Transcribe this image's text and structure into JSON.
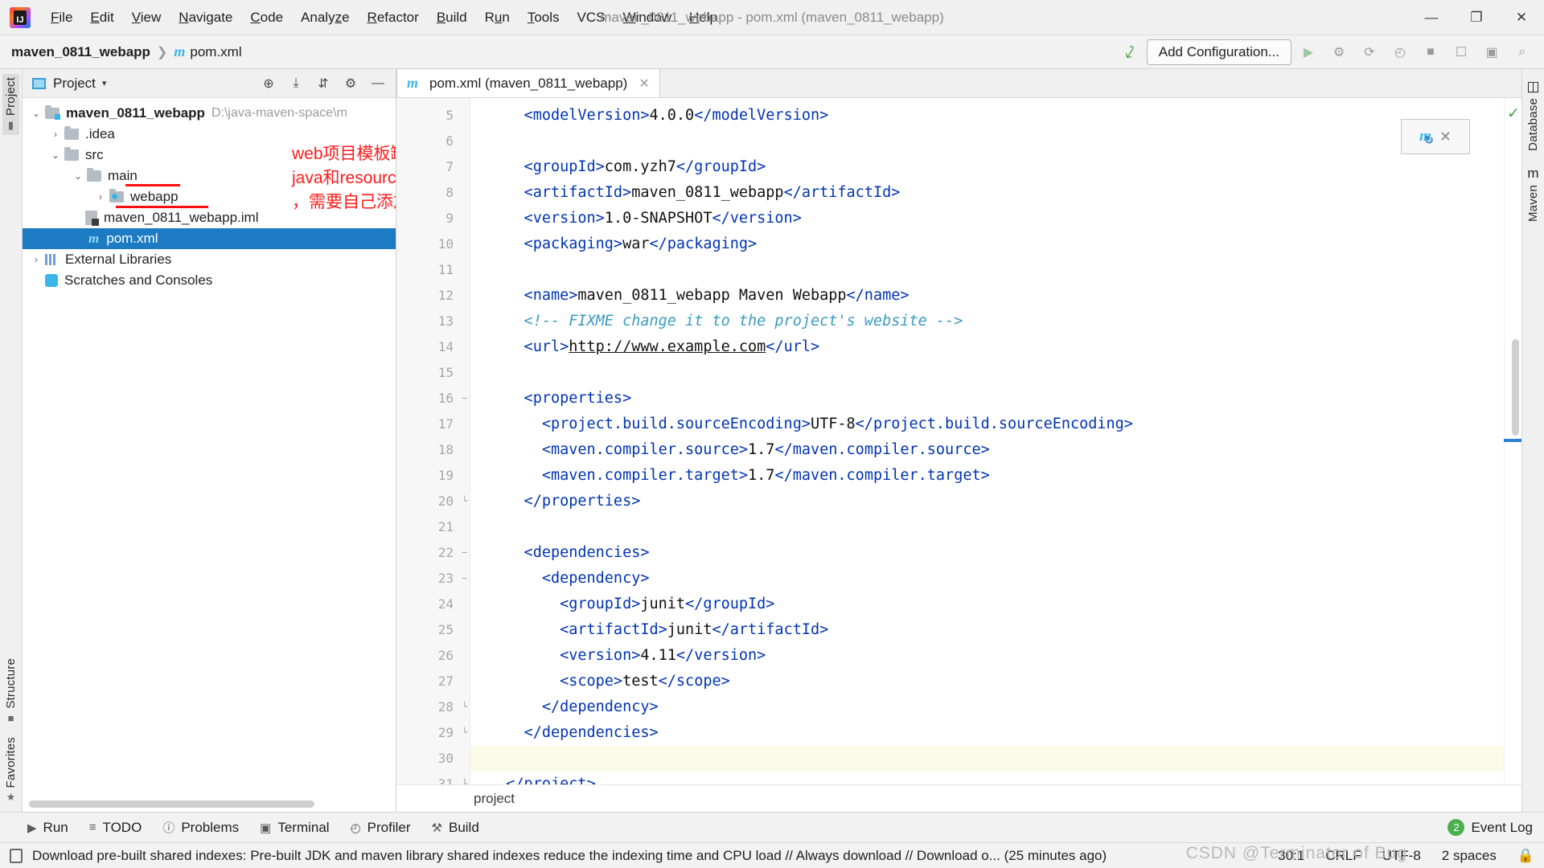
{
  "window": {
    "title": "maven_0811_webapp - pom.xml (maven_0811_webapp)",
    "minimize": "—",
    "maximize": "❐",
    "close": "✕"
  },
  "menubar": {
    "items": [
      {
        "label": "File",
        "mnemonic": "F"
      },
      {
        "label": "Edit",
        "mnemonic": "E"
      },
      {
        "label": "View",
        "mnemonic": "V"
      },
      {
        "label": "Navigate",
        "mnemonic": "N"
      },
      {
        "label": "Code",
        "mnemonic": "C"
      },
      {
        "label": "Analyze",
        "mnemonic": "z"
      },
      {
        "label": "Refactor",
        "mnemonic": "R"
      },
      {
        "label": "Build",
        "mnemonic": "B"
      },
      {
        "label": "Run",
        "mnemonic": "u"
      },
      {
        "label": "Tools",
        "mnemonic": "T"
      },
      {
        "label": "VCS",
        "mnemonic": ""
      },
      {
        "label": "Window",
        "mnemonic": "W"
      },
      {
        "label": "Help",
        "mnemonic": "H"
      }
    ]
  },
  "navbar": {
    "project_name": "maven_0811_webapp",
    "separator": "❯",
    "file_name": "pom.xml",
    "file_icon": "m",
    "add_configuration": "Add Configuration...",
    "run_icon": "▶",
    "debug_icon": "⚙",
    "coverage_icon": "⟳",
    "profile_icon": "◴",
    "stop_icon": "■",
    "search_icon": "⌕"
  },
  "left_rail": {
    "project_label": "Project",
    "structure_label": "Structure",
    "favorites_label": "Favorites",
    "favorites_icon": "★"
  },
  "right_rail": {
    "database_label": "Database",
    "maven_label": "Maven",
    "maven_icon": "m"
  },
  "project_panel": {
    "title": "Project",
    "caret": "▾",
    "actions": [
      "target-icon",
      "expand-all-icon",
      "collapse-all-icon",
      "gear-icon",
      "hide-icon"
    ],
    "action_glyphs": [
      "⊕",
      "⤓",
      "⇵",
      "⚙",
      "—"
    ],
    "tree": [
      {
        "label": "maven_0811_webapp",
        "path": "D:\\java-maven-space\\m",
        "arrow": "⌄",
        "icon": "module-folder",
        "depth": 0,
        "bold": true,
        "selected": false
      },
      {
        "label": ".idea",
        "path": "",
        "arrow": "›",
        "icon": "folder",
        "depth": 1,
        "bold": false,
        "selected": false
      },
      {
        "label": "src",
        "path": "",
        "arrow": "⌄",
        "icon": "folder",
        "depth": 1,
        "bold": false,
        "selected": false
      },
      {
        "label": "main",
        "path": "",
        "arrow": "⌄",
        "icon": "folder",
        "depth": 2,
        "bold": false,
        "selected": false
      },
      {
        "label": "webapp",
        "path": "",
        "arrow": "›",
        "icon": "web-folder",
        "depth": 3,
        "bold": false,
        "selected": false
      },
      {
        "label": "maven_0811_webapp.iml",
        "path": "",
        "arrow": "",
        "icon": "iml-file",
        "depth": 2,
        "bold": false,
        "selected": false
      },
      {
        "label": "pom.xml",
        "path": "",
        "arrow": "",
        "icon": "maven-file",
        "depth": 2,
        "bold": false,
        "selected": true
      },
      {
        "label": "External Libraries",
        "path": "",
        "arrow": "›",
        "icon": "library",
        "depth": 0,
        "bold": false,
        "selected": false
      },
      {
        "label": "Scratches and Consoles",
        "path": "",
        "arrow": "",
        "icon": "scratch",
        "depth": 0,
        "bold": false,
        "selected": false
      }
    ],
    "annotation": {
      "line1": "web项目模板缺少",
      "line2": "java和resources模板",
      "line3": "，需要自己添加",
      "color": "#ff1a1a"
    }
  },
  "editor": {
    "tab": {
      "label": "pom.xml (maven_0811_webapp)",
      "icon": "m",
      "close": "✕"
    },
    "breadcrumb": "project",
    "inspection_ok": "✓",
    "float_panel": {
      "icon": "m",
      "close": "✕"
    },
    "first_line_number": 5,
    "lines": [
      {
        "n": 5,
        "fold": "",
        "segments": [
          {
            "t": "tag",
            "v": "    <modelVersion>"
          },
          {
            "t": "txt",
            "v": "4.0.0"
          },
          {
            "t": "tag",
            "v": "</modelVersion>"
          }
        ]
      },
      {
        "n": 6,
        "fold": "",
        "segments": []
      },
      {
        "n": 7,
        "fold": "",
        "segments": [
          {
            "t": "tag",
            "v": "    <groupId>"
          },
          {
            "t": "txt",
            "v": "com.yzh7"
          },
          {
            "t": "tag",
            "v": "</groupId>"
          }
        ]
      },
      {
        "n": 8,
        "fold": "",
        "segments": [
          {
            "t": "tag",
            "v": "    <artifactId>"
          },
          {
            "t": "txt",
            "v": "maven_0811_webapp"
          },
          {
            "t": "tag",
            "v": "</artifactId>"
          }
        ]
      },
      {
        "n": 9,
        "fold": "",
        "segments": [
          {
            "t": "tag",
            "v": "    <version>"
          },
          {
            "t": "txt",
            "v": "1.0-SNAPSHOT"
          },
          {
            "t": "tag",
            "v": "</version>"
          }
        ]
      },
      {
        "n": 10,
        "fold": "",
        "segments": [
          {
            "t": "tag",
            "v": "    <packaging>"
          },
          {
            "t": "txt",
            "v": "war"
          },
          {
            "t": "tag",
            "v": "</packaging>"
          }
        ]
      },
      {
        "n": 11,
        "fold": "",
        "segments": []
      },
      {
        "n": 12,
        "fold": "",
        "segments": [
          {
            "t": "tag",
            "v": "    <name>"
          },
          {
            "t": "txt",
            "v": "maven_0811_webapp Maven Webapp"
          },
          {
            "t": "tag",
            "v": "</name>"
          }
        ]
      },
      {
        "n": 13,
        "fold": "",
        "segments": [
          {
            "t": "cm",
            "v": "    <!-- FIXME change it to the project's website -->"
          }
        ]
      },
      {
        "n": 14,
        "fold": "",
        "segments": [
          {
            "t": "tag",
            "v": "    <url>"
          },
          {
            "t": "url",
            "v": "http://www.example.com"
          },
          {
            "t": "tag",
            "v": "</url>"
          }
        ]
      },
      {
        "n": 15,
        "fold": "",
        "segments": []
      },
      {
        "n": 16,
        "fold": "−",
        "segments": [
          {
            "t": "tag",
            "v": "    <properties>"
          }
        ]
      },
      {
        "n": 17,
        "fold": "",
        "segments": [
          {
            "t": "tag",
            "v": "      <project.build.sourceEncoding>"
          },
          {
            "t": "txt",
            "v": "UTF-8"
          },
          {
            "t": "tag",
            "v": "</project.build.sourceEncoding>"
          }
        ]
      },
      {
        "n": 18,
        "fold": "",
        "segments": [
          {
            "t": "tag",
            "v": "      <maven.compiler.source>"
          },
          {
            "t": "txt",
            "v": "1.7"
          },
          {
            "t": "tag",
            "v": "</maven.compiler.source>"
          }
        ]
      },
      {
        "n": 19,
        "fold": "",
        "segments": [
          {
            "t": "tag",
            "v": "      <maven.compiler.target>"
          },
          {
            "t": "txt",
            "v": "1.7"
          },
          {
            "t": "tag",
            "v": "</maven.compiler.target>"
          }
        ]
      },
      {
        "n": 20,
        "fold": "└",
        "segments": [
          {
            "t": "tag",
            "v": "    </properties>"
          }
        ]
      },
      {
        "n": 21,
        "fold": "",
        "segments": []
      },
      {
        "n": 22,
        "fold": "−",
        "segments": [
          {
            "t": "tag",
            "v": "    <dependencies>"
          }
        ]
      },
      {
        "n": 23,
        "fold": "−",
        "segments": [
          {
            "t": "tag",
            "v": "      <dependency>"
          }
        ]
      },
      {
        "n": 24,
        "fold": "",
        "segments": [
          {
            "t": "tag",
            "v": "        <groupId>"
          },
          {
            "t": "txt",
            "v": "junit"
          },
          {
            "t": "tag",
            "v": "</groupId>"
          }
        ]
      },
      {
        "n": 25,
        "fold": "",
        "segments": [
          {
            "t": "tag",
            "v": "        <artifactId>"
          },
          {
            "t": "txt",
            "v": "junit"
          },
          {
            "t": "tag",
            "v": "</artifactId>"
          }
        ]
      },
      {
        "n": 26,
        "fold": "",
        "segments": [
          {
            "t": "tag",
            "v": "        <version>"
          },
          {
            "t": "txt",
            "v": "4.11"
          },
          {
            "t": "tag",
            "v": "</version>"
          }
        ]
      },
      {
        "n": 27,
        "fold": "",
        "segments": [
          {
            "t": "tag",
            "v": "        <scope>"
          },
          {
            "t": "txt",
            "v": "test"
          },
          {
            "t": "tag",
            "v": "</scope>"
          }
        ]
      },
      {
        "n": 28,
        "fold": "└",
        "segments": [
          {
            "t": "tag",
            "v": "      </dependency>"
          }
        ]
      },
      {
        "n": 29,
        "fold": "└",
        "segments": [
          {
            "t": "tag",
            "v": "    </dependencies>"
          }
        ]
      },
      {
        "n": 30,
        "fold": "",
        "segments": [],
        "current": true
      },
      {
        "n": 31,
        "fold": "└",
        "segments": [
          {
            "t": "tag",
            "v": "  </project>"
          }
        ]
      }
    ]
  },
  "tool_window_bar": {
    "items": [
      {
        "label": "Run",
        "icon": "▶"
      },
      {
        "label": "TODO",
        "icon": "≡"
      },
      {
        "label": "Problems",
        "icon": "ⓘ"
      },
      {
        "label": "Terminal",
        "icon": "▣"
      },
      {
        "label": "Profiler",
        "icon": "◴"
      },
      {
        "label": "Build",
        "icon": "⚒"
      }
    ],
    "event_log": {
      "label": "Event Log",
      "count": "2"
    }
  },
  "statusbar": {
    "message": "Download pre-built shared indexes: Pre-built JDK and maven library shared indexes reduce the indexing time and CPU load // Always download // Download o... (25 minutes ago)",
    "caret_position": "30:1",
    "line_separator": "CRLF",
    "encoding": "UTF-8",
    "indent": "2 spaces",
    "lock_icon": "🔒"
  },
  "watermark": "CSDN @Terminator of Bug",
  "colors": {
    "accent_blue": "#1d7bc4",
    "tag_blue": "#0033b3",
    "comment": "#3a9bbf",
    "annotation_red": "#ff1a1a",
    "maven_cyan": "#3ab6e8",
    "ok_green": "#4a9e4a"
  }
}
